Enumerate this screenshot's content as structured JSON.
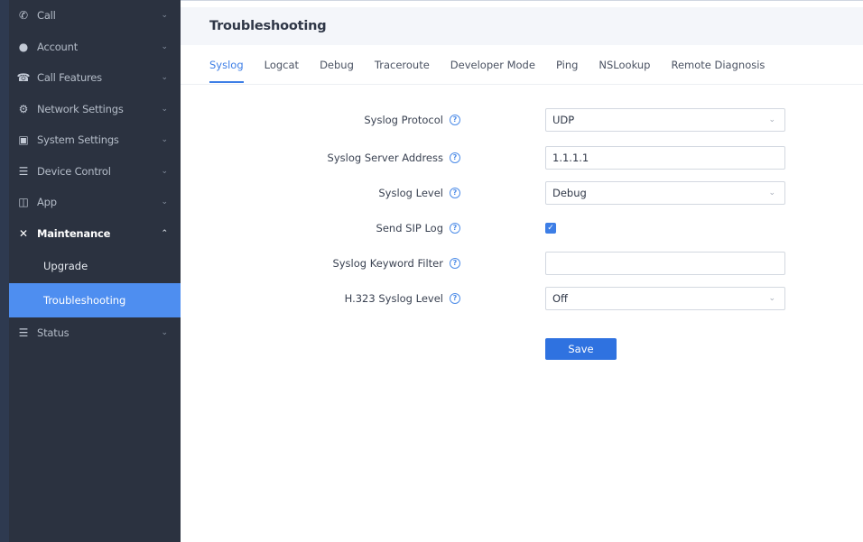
{
  "sidebar": {
    "items": [
      {
        "label": "Call",
        "icon": "phone-call-icon"
      },
      {
        "label": "Account",
        "icon": "user-icon"
      },
      {
        "label": "Call Features",
        "icon": "phone-icon"
      },
      {
        "label": "Network Settings",
        "icon": "network-icon"
      },
      {
        "label": "System Settings",
        "icon": "system-settings-icon"
      },
      {
        "label": "Device Control",
        "icon": "list-icon"
      },
      {
        "label": "App",
        "icon": "app-icon"
      },
      {
        "label": "Maintenance",
        "icon": "tools-icon"
      },
      {
        "label": "Status",
        "icon": "list-icon"
      }
    ],
    "maintenance_sub": [
      {
        "label": "Upgrade"
      },
      {
        "label": "Troubleshooting"
      }
    ]
  },
  "header": {
    "title": "Troubleshooting"
  },
  "tabs": [
    {
      "label": "Syslog"
    },
    {
      "label": "Logcat"
    },
    {
      "label": "Debug"
    },
    {
      "label": "Traceroute"
    },
    {
      "label": "Developer Mode"
    },
    {
      "label": "Ping"
    },
    {
      "label": "NSLookup"
    },
    {
      "label": "Remote Diagnosis"
    }
  ],
  "form": {
    "syslog_protocol": {
      "label": "Syslog Protocol",
      "value": "UDP"
    },
    "syslog_server_address": {
      "label": "Syslog Server Address",
      "value": "1.1.1.1"
    },
    "syslog_level": {
      "label": "Syslog Level",
      "value": "Debug"
    },
    "send_sip_log": {
      "label": "Send SIP Log",
      "checked": true
    },
    "syslog_keyword_filter": {
      "label": "Syslog Keyword Filter",
      "value": ""
    },
    "h323_syslog_level": {
      "label": "H.323 Syslog Level",
      "value": "Off"
    },
    "save_label": "Save"
  },
  "colors": {
    "accent": "#3d7ee6",
    "sidebar": "#2b3240",
    "active_item": "#4e8ef0"
  }
}
